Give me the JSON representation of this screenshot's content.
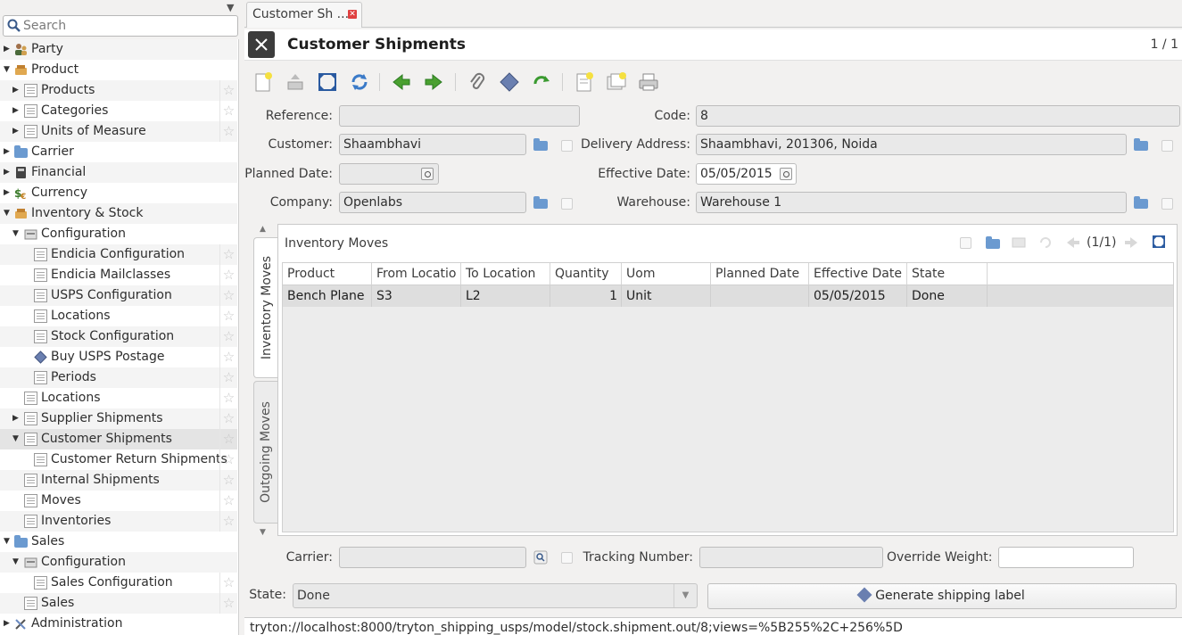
{
  "sidebar": {
    "search_placeholder": "Search",
    "items": [
      {
        "label": "Party"
      },
      {
        "label": "Product"
      },
      {
        "label": "Products"
      },
      {
        "label": "Categories"
      },
      {
        "label": "Units of Measure"
      },
      {
        "label": "Carrier"
      },
      {
        "label": "Financial"
      },
      {
        "label": "Currency"
      },
      {
        "label": "Inventory & Stock"
      },
      {
        "label": "Configuration"
      },
      {
        "label": "Endicia Configuration"
      },
      {
        "label": "Endicia Mailclasses"
      },
      {
        "label": "USPS Configuration"
      },
      {
        "label": "Locations"
      },
      {
        "label": "Stock Configuration"
      },
      {
        "label": "Buy USPS Postage"
      },
      {
        "label": "Periods"
      },
      {
        "label": "Locations"
      },
      {
        "label": "Supplier Shipments"
      },
      {
        "label": "Customer Shipments"
      },
      {
        "label": "Customer Return Shipments"
      },
      {
        "label": "Internal Shipments"
      },
      {
        "label": "Moves"
      },
      {
        "label": "Inventories"
      },
      {
        "label": "Sales"
      },
      {
        "label": "Configuration"
      },
      {
        "label": "Sales Configuration"
      },
      {
        "label": "Sales"
      },
      {
        "label": "Administration"
      }
    ]
  },
  "tab": {
    "label": "Customer Sh ..."
  },
  "form": {
    "title": "Customer Shipments",
    "record_count": "1 / 1",
    "fields": {
      "reference": {
        "label": "Reference:",
        "value": ""
      },
      "code": {
        "label": "Code:",
        "value": "8"
      },
      "customer": {
        "label": "Customer:",
        "value": "Shaambhavi"
      },
      "delivery_address": {
        "label": "Delivery Address:",
        "value": "Shaambhavi, 201306, Noida"
      },
      "planned_date": {
        "label": "Planned Date:",
        "value": ""
      },
      "effective_date": {
        "label": "Effective Date:",
        "value": "05/05/2015"
      },
      "company": {
        "label": "Company:",
        "value": "Openlabs"
      },
      "warehouse": {
        "label": "Warehouse:",
        "value": "Warehouse 1"
      },
      "carrier": {
        "label": "Carrier:",
        "value": ""
      },
      "tracking_number": {
        "label": "Tracking Number:",
        "value": ""
      },
      "override_weight": {
        "label": "Override Weight:",
        "value": ""
      },
      "state": {
        "label": "State:",
        "value": "Done"
      }
    },
    "generate_button": "Generate shipping label"
  },
  "notebook": {
    "tabs": [
      "Inventory Moves",
      "Outgoing Moves"
    ],
    "active_tab": "Inventory Moves"
  },
  "moves": {
    "title": "Inventory Moves",
    "pager": "(1/1)",
    "columns": [
      "Product",
      "From Locatio",
      "To Location",
      "Quantity",
      "Uom",
      "Planned Date",
      "Effective Date",
      "State"
    ],
    "rows": [
      [
        "Bench Plane",
        "S3",
        "L2",
        "1",
        "Unit",
        "",
        "05/05/2015",
        "Done"
      ]
    ]
  },
  "statusbar": {
    "url": "tryton://localhost:8000/tryton_shipping_usps/model/stock.shipment.out/8;views=%5B255%2C+256%5D"
  }
}
